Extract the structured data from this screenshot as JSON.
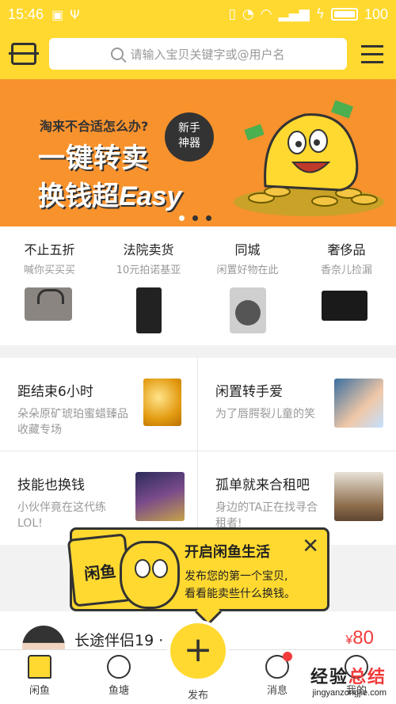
{
  "status_bar": {
    "time": "15:46",
    "battery": "100"
  },
  "header": {
    "search_placeholder": "请输入宝贝关键字或@用户名"
  },
  "banner": {
    "question": "淘来不合适怎么办?",
    "line1": "一键转卖",
    "line2_cn": "换钱超",
    "line2_en": "Easy",
    "badge_line1": "新手",
    "badge_line2": "神器",
    "page_count": 3,
    "active_page": 1
  },
  "categories": [
    {
      "title": "不止五折",
      "subtitle": "喊你买买买",
      "image": "handbag"
    },
    {
      "title": "法院卖货",
      "subtitle": "10元拍诺基亚",
      "image": "nokia-phone"
    },
    {
      "title": "同城",
      "subtitle": "闲置好物在此",
      "image": "washing-machine"
    },
    {
      "title": "奢侈品",
      "subtitle": "香奈儿捡漏",
      "image": "chanel-bag"
    }
  ],
  "grid": [
    {
      "title": "距结束6小时",
      "subtitle": "朵朵原矿琥珀蜜蜡臻品收藏专场",
      "image": "amber"
    },
    {
      "title": "闲置转手爱",
      "subtitle": "为了唇腭裂儿童的笑",
      "image": "child-photo"
    },
    {
      "title": "技能也换钱",
      "subtitle": "小伙伴竟在这代练LOL!",
      "image": "league-of-legends"
    },
    {
      "title": "孤单就来合租吧",
      "subtitle": "身边的TA正在找寻合租者!",
      "image": "room-photo"
    }
  ],
  "popup": {
    "logo_text": "闲鱼",
    "title": "开启闲鱼生活",
    "desc_line1": "发布您的第一个宝贝,",
    "desc_line2": "看看能卖些什么换钱。"
  },
  "feed": {
    "name": "长途伴侣19 ·",
    "price_symbol": "¥",
    "price": "80"
  },
  "tabbar": [
    {
      "label": "闲鱼",
      "icon": "home-icon"
    },
    {
      "label": "鱼塘",
      "icon": "pond-icon"
    },
    {
      "label": "发布",
      "icon": "plus-icon"
    },
    {
      "label": "消息",
      "icon": "message-icon"
    },
    {
      "label": "我的",
      "icon": "profile-icon"
    }
  ],
  "watermark": {
    "line1_a": "经验",
    "line1_b": "总结",
    "line2": "jingyanzongjie.com"
  },
  "colors": {
    "brand_yellow": "#ffd930",
    "banner_orange": "#f7922d",
    "price_red": "#f23b3b"
  }
}
